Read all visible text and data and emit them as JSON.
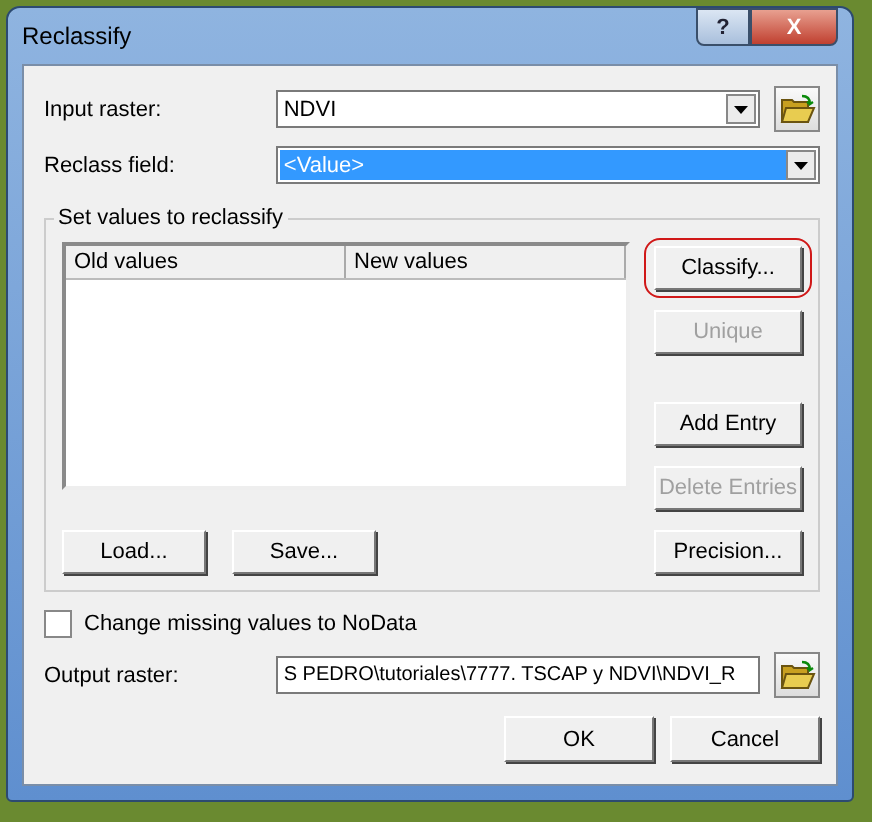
{
  "window": {
    "title": "Reclassify",
    "controls": [
      {
        "kind": "help",
        "glyph": "?"
      },
      {
        "kind": "close",
        "glyph": "X"
      }
    ]
  },
  "input_raster": {
    "label": "Input raster:",
    "value": "NDVI"
  },
  "reclass_field": {
    "label": "Reclass field:",
    "value": "<Value>",
    "selected": true
  },
  "group": {
    "title": "Set values to reclassify",
    "table": {
      "columns": [
        "Old values",
        "New values"
      ]
    },
    "side_buttons": [
      {
        "label": "Classify...",
        "disabled": false,
        "circled": true
      },
      {
        "label": "Unique",
        "disabled": true,
        "circled": false
      },
      {
        "label": "Add Entry",
        "disabled": false,
        "circled": false
      },
      {
        "label": "Delete Entries",
        "disabled": true,
        "circled": false
      }
    ],
    "bottom_buttons": [
      "Load...",
      "Save..."
    ],
    "precision_button": "Precision..."
  },
  "missing_checkbox": {
    "label": "Change missing values to NoData",
    "checked": false
  },
  "output_raster": {
    "label": "Output raster:",
    "value": "S PEDRO\\tutoriales\\7777. TSCAP y NDVI\\NDVI_R"
  },
  "buttons": [
    "OK",
    "Cancel"
  ]
}
